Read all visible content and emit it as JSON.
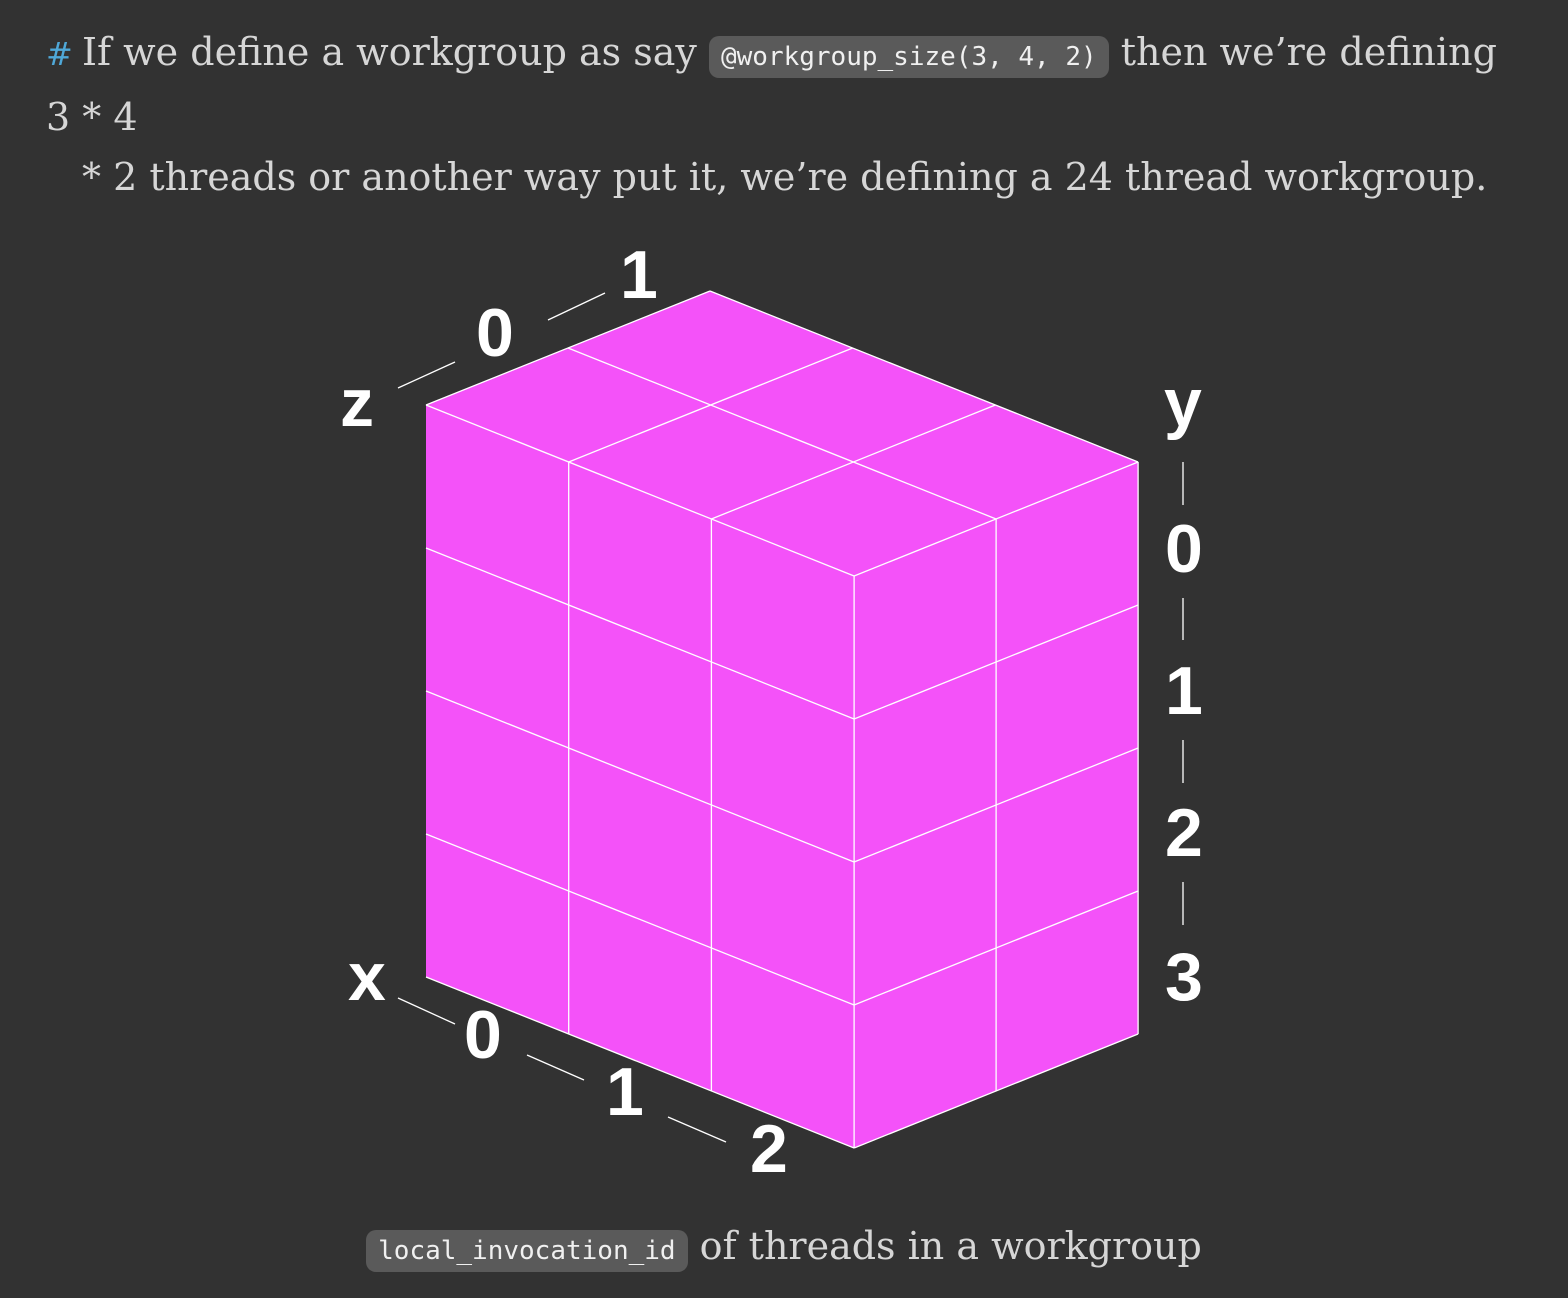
{
  "paragraph": {
    "hash": "#",
    "text_before_code": "If we define a workgroup as say",
    "code": "@workgroup_size(3, 4, 2)",
    "text_after_code": "then we’re defining 3 * 4",
    "line2": "* 2 threads or another way put it, we’re defining a 24 thread workgroup."
  },
  "diagram": {
    "cube_color": "#f452f9",
    "grid_line_color": "#ffffff",
    "dimensions": {
      "x": 3,
      "y": 4,
      "z": 2
    },
    "axes": {
      "x": {
        "name": "x",
        "ticks": [
          "0",
          "1",
          "2"
        ]
      },
      "y": {
        "name": "y",
        "ticks": [
          "0",
          "1",
          "2",
          "3"
        ]
      },
      "z": {
        "name": "z",
        "ticks": [
          "0",
          "1"
        ]
      }
    }
  },
  "caption": {
    "code": "local_invocation_id",
    "text": "of threads in a workgroup"
  }
}
